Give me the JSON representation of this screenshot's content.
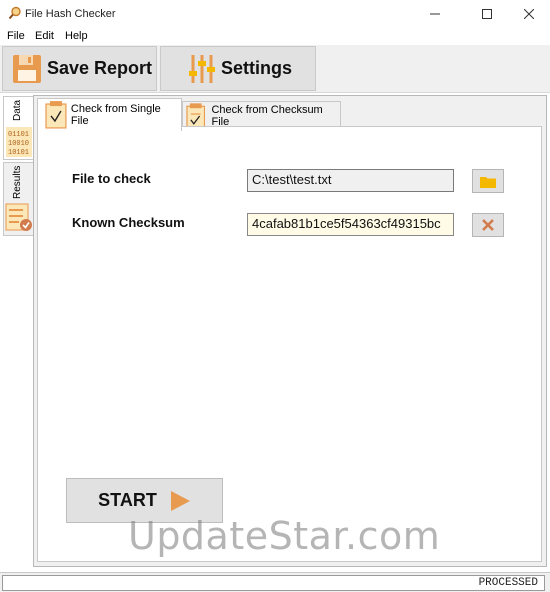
{
  "window": {
    "title": "File Hash Checker"
  },
  "menu": {
    "items": [
      "File",
      "Edit",
      "Help"
    ]
  },
  "toolbar": {
    "save_label": "Save Report",
    "settings_label": "Settings"
  },
  "side_tabs": {
    "data_label": "Data",
    "results_label": "Results"
  },
  "tabs": [
    {
      "label": "Check from Single File",
      "selected": true
    },
    {
      "label": "Check from Checksum File",
      "selected": false
    }
  ],
  "form": {
    "file_label": "File to check",
    "file_value": "C:\\test\\test.txt",
    "checksum_label": "Known Checksum",
    "checksum_value": "4cafab81b1ce5f54363cf49315bc"
  },
  "start_label": "START",
  "watermark": "UpdateStar.com",
  "status": "PROCESSED",
  "colors": {
    "accent": "#e89a4f",
    "folder": "#f5b800",
    "clear": "#d27b4c",
    "checksum_bg": "#fffbe6"
  }
}
